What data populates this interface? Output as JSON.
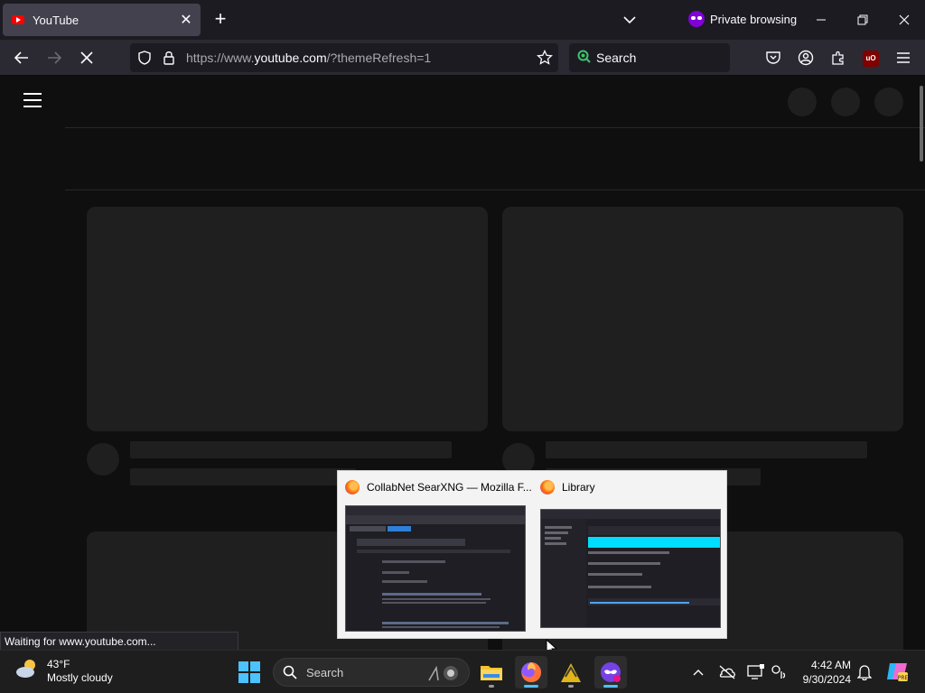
{
  "browser": {
    "tab": {
      "title": "YouTube",
      "close_glyph": "✕"
    },
    "new_tab_glyph": "+",
    "private_label": "Private browsing",
    "url": {
      "prefix": "https://www.",
      "host": "youtube.com",
      "suffix": "/?themeRefresh=1"
    },
    "search_placeholder": "Search",
    "status_text": "Waiting for www.youtube.com..."
  },
  "preview": {
    "items": [
      {
        "title": "CollabNet SearXNG — Mozilla F..."
      },
      {
        "title": "Library"
      }
    ]
  },
  "taskbar": {
    "weather": {
      "temp": "43°F",
      "condition": "Mostly cloudy"
    },
    "search_placeholder": "Search",
    "clock": {
      "time": "4:42 AM",
      "date": "9/30/2024"
    }
  },
  "colors": {
    "accent": "#4cc2ff",
    "private": "#8000d7",
    "youtube_red": "#ff0000"
  }
}
